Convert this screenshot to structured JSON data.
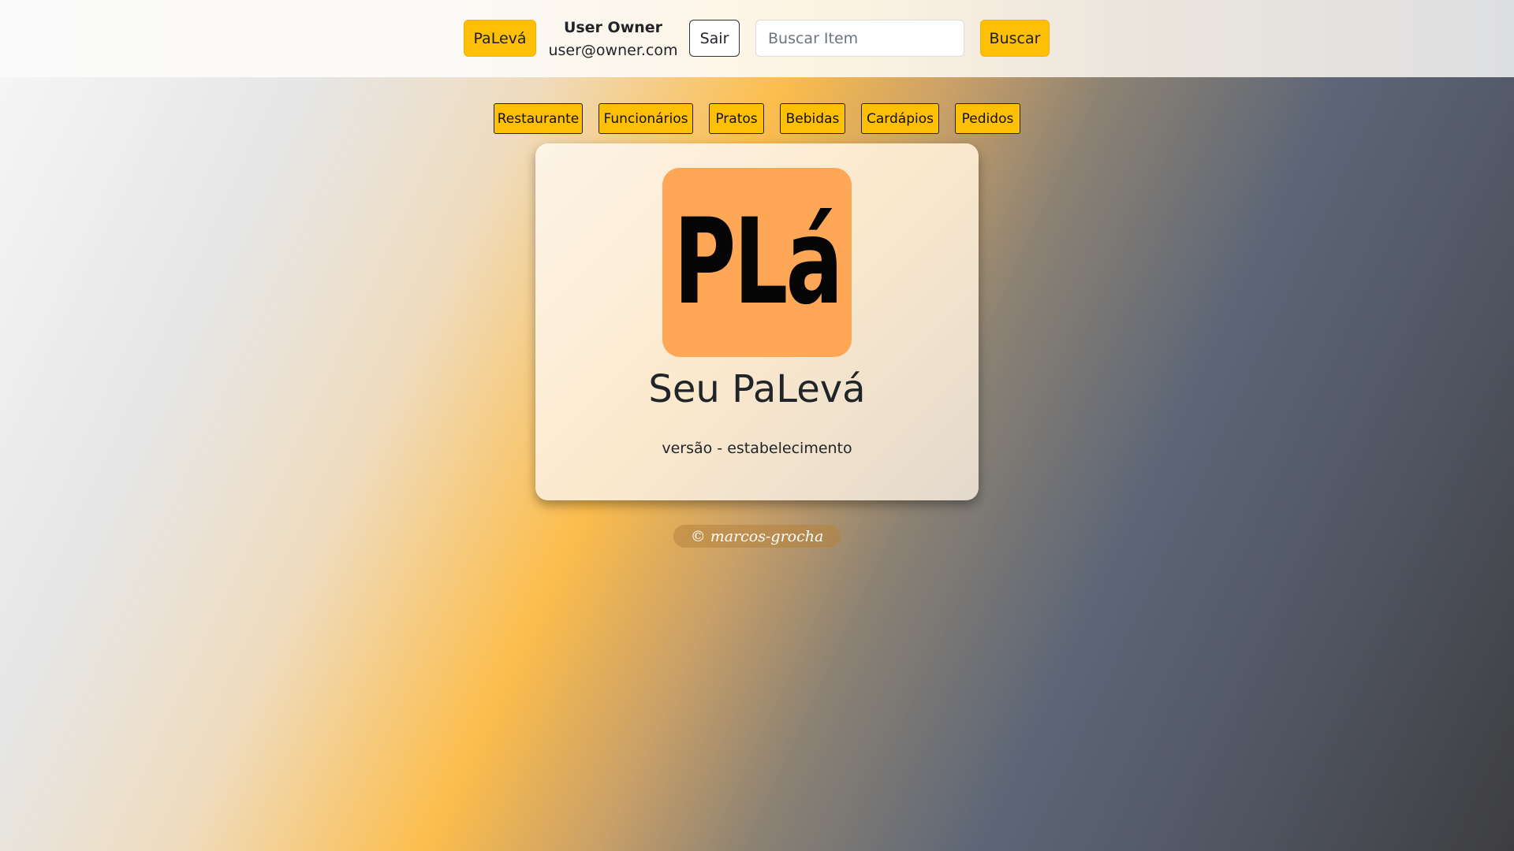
{
  "header": {
    "brand_label": "PaLevá",
    "user_name": "User Owner",
    "user_email": "user@owner.com",
    "logout_label": "Sair",
    "search_placeholder": "Buscar Item",
    "search_value": "",
    "search_button_label": "Buscar"
  },
  "nav": {
    "items": [
      {
        "label": "Restaurante"
      },
      {
        "label": "Funcionários"
      },
      {
        "label": "Pratos"
      },
      {
        "label": "Bebidas"
      },
      {
        "label": "Cardápios"
      },
      {
        "label": "Pedidos"
      }
    ]
  },
  "card": {
    "logo_text": "PLá",
    "title": "Seu PaLevá",
    "subtitle": "versão - estabelecimento"
  },
  "footer": {
    "text": "© marcos-grocha"
  },
  "colors": {
    "accent": "#fdc007",
    "logo_background": "#fea756"
  }
}
